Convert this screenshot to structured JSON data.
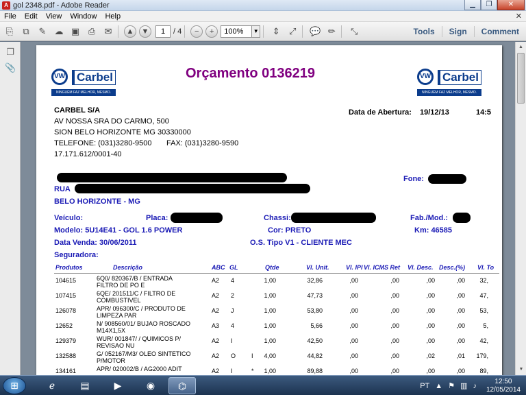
{
  "window": {
    "title": "gol 2348.pdf - Adobe Reader",
    "app_icon": "pdf-icon",
    "minimize": "▁",
    "maximize": "❐",
    "close": "✕"
  },
  "menu": {
    "items": [
      "File",
      "Edit",
      "View",
      "Window",
      "Help"
    ],
    "close_doc": "✕"
  },
  "toolbar": {
    "page_current": "1",
    "page_total": "/ 4",
    "zoom": "100%",
    "links": [
      "Tools",
      "Sign",
      "Comment"
    ]
  },
  "document": {
    "title": "Orçamento 0136219",
    "logo_word": "Carbel",
    "logo_slogan": "NINGUÉM FAZ MELHOR, MESMO.",
    "company": {
      "name": "CARBEL S/A",
      "address": "AV NOSSA SRA DO CARMO, 500",
      "city": "SION BELO HORIZONTE MG 30330000",
      "phone": "TELEFONE: (031)3280-9500",
      "fax": "FAX:  (031)3280-9590",
      "cnpj": "17.171.612/0001-40"
    },
    "opening_label": "Data de Abertura:",
    "opening_date": "19/12/13",
    "opening_time": "14:5",
    "customer": {
      "fone_label": "Fone:",
      "street_prefix": "RUA",
      "city": "BELO HORIZONTE - MG"
    },
    "vehicle": {
      "veiculo_label": "Veículo:",
      "placa_label": "Placa:",
      "chassi_label": "Chassi:",
      "fab_label": "Fab./Mod.:",
      "modelo": "Modelo:  5U14E41 - GOL 1.6 POWER",
      "cor": "Cor: PRETO",
      "km": "Km:  46585",
      "data_venda": "Data Venda:  30/06/2011",
      "os_tipo": "O.S. Tipo V1 - CLIENTE MEC",
      "seguradora": "Seguradora:"
    },
    "columns": [
      "Produtos",
      "Descrição",
      "ABC",
      "GL",
      "Qtde",
      "Vl. Unit.",
      "Vl. IPI",
      "Vl. ICMS Ret",
      "Vl. Desc.",
      "Desc.(%)",
      "Vl. To"
    ],
    "rows": [
      {
        "code": "104615",
        "desc": "6Q0/  820367/B / ENTRADA FILTRO DE PO E",
        "abc": "A2",
        "gl": "4",
        "flag": "",
        "qtde": "1,00",
        "unit": "32,86",
        "ipi": ",00",
        "icms": ",00",
        "desc_v": ",00",
        "desc_p": ",00",
        "total": "32,"
      },
      {
        "code": "107415",
        "desc": "6QE/  201511/C / FILTRO DE COMBUSTIVEL",
        "abc": "A2",
        "gl": "2",
        "flag": "",
        "qtde": "1,00",
        "unit": "47,73",
        "ipi": ",00",
        "icms": ",00",
        "desc_v": ",00",
        "desc_p": ",00",
        "total": "47,"
      },
      {
        "code": "126078",
        "desc": "APR/  096300/C / PRODUTO DE LIMPEZA PAR",
        "abc": "A2",
        "gl": "J",
        "flag": "",
        "qtde": "1,00",
        "unit": "53,80",
        "ipi": ",00",
        "icms": ",00",
        "desc_v": ",00",
        "desc_p": ",00",
        "total": "53,"
      },
      {
        "code": "12652",
        "desc": "N/  908560/01/ BUJAO ROSCADO M14X1,5X",
        "abc": "A3",
        "gl": "4",
        "flag": "",
        "qtde": "1,00",
        "unit": "5,66",
        "ipi": ",00",
        "icms": ",00",
        "desc_v": ",00",
        "desc_p": ",00",
        "total": "5,"
      },
      {
        "code": "129379",
        "desc": "WUR/  001847/ / QUIMICOS P/ REVISAO NU",
        "abc": "A2",
        "gl": "I",
        "flag": "",
        "qtde": "1,00",
        "unit": "42,50",
        "ipi": ",00",
        "icms": ",00",
        "desc_v": ",00",
        "desc_p": ",00",
        "total": "42,"
      },
      {
        "code": "132588",
        "desc": "G/  052167/M3/ OLEO SINTETICO P/MOTOR",
        "abc": "A2",
        "gl": "O",
        "flag": "I",
        "qtde": "4,00",
        "unit": "44,82",
        "ipi": ",00",
        "icms": ",00",
        "desc_v": ",02",
        "desc_p": ",01",
        "total": "179,"
      },
      {
        "code": "134161",
        "desc": "APR/  020002/B / AG2000 ADIT",
        "abc": "A2",
        "gl": "I",
        "flag": "*",
        "qtde": "1,00",
        "unit": "89,88",
        "ipi": ",00",
        "icms": ",00",
        "desc_v": ",00",
        "desc_p": ",00",
        "total": "89,"
      }
    ]
  },
  "taskbar": {
    "lang": "PT",
    "time": "12:50",
    "date": "12/05/2014"
  }
}
